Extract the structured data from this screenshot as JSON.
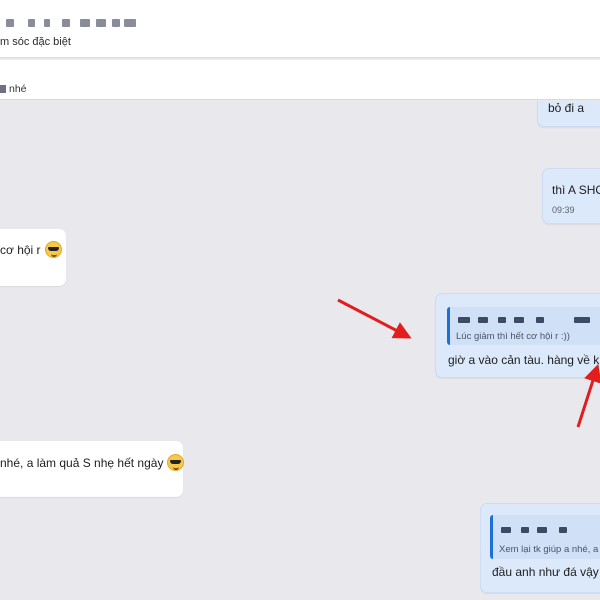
{
  "header": {
    "subtitle": "m sóc đặc biệt"
  },
  "pinned": {
    "text": "nhé"
  },
  "messages": [
    {
      "direction": "out",
      "text": "bỏ đi a"
    },
    {
      "direction": "out",
      "text": "thì A SHO",
      "time": "09:39"
    },
    {
      "direction": "in",
      "text": "cơ hội r",
      "emoji": "smiling-face-with-sunglasses"
    },
    {
      "direction": "out",
      "quote": "Lúc giảm thì hết cơ hội r :))",
      "text": "giờ a vào cản tàu. hàng về k ch"
    },
    {
      "direction": "in",
      "text": "nhé, a làm quả S nhẹ hết ngày",
      "emoji": "smiling-face-with-sunglasses"
    },
    {
      "direction": "out",
      "quote": "Xem lại tk giúp a nhé, a",
      "text": "đầu anh như đá vậy @"
    }
  ],
  "colors": {
    "background": "#e9e8ed",
    "incoming": "#ffffff",
    "outgoing": "#dbe9fb",
    "quote_bar": "#1b6fd6",
    "annotation_arrow": "#e11d1d"
  }
}
